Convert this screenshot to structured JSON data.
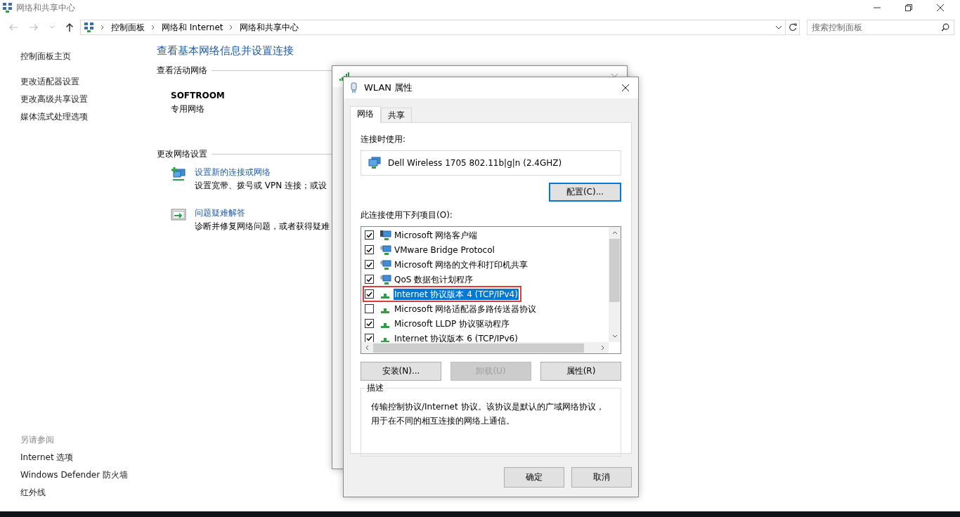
{
  "window": {
    "title": "网络和共享中心"
  },
  "address_bar": {
    "crumbs": [
      "控制面板",
      "网络和 Internet",
      "网络和共享中心"
    ]
  },
  "search": {
    "placeholder": "搜索控制面板"
  },
  "sidebar": {
    "items": [
      "控制面板主页",
      "更改适配器设置",
      "更改高级共享设置",
      "媒体流式处理选项"
    ],
    "see_also": {
      "heading": "另请参阅",
      "items": [
        "Internet 选项",
        "Windows Defender 防火墙",
        "红外线"
      ]
    }
  },
  "content": {
    "heading": "查看基本网络信息并设置连接",
    "active_networks": {
      "heading": "查看活动网络",
      "name": "SOFTROOM",
      "type": "专用网络"
    },
    "change_settings": {
      "heading": "更改网络设置",
      "tasks": [
        {
          "kind": "new-connection",
          "link": "设置新的连接或网络",
          "description": "设置宽带、拨号或 VPN 连接；或设"
        },
        {
          "kind": "troubleshoot",
          "link": "问题疑难解答",
          "description": "诊断并修复网络问题，或者获得疑难"
        }
      ]
    }
  },
  "properties_dialog": {
    "title": "WLAN 属性",
    "tabs": [
      {
        "label": "网络",
        "selected": true
      },
      {
        "label": "共享",
        "selected": false
      }
    ],
    "connect_using_label": "连接时使用:",
    "adapter": "Dell Wireless 1705 802.11b|g|n (2.4GHZ)",
    "configure_button": "配置(C)...",
    "items_label": "此连接使用下列项目(O):",
    "items": [
      {
        "label": "Microsoft 网络客户端",
        "kind": "client",
        "checked": true,
        "selected": false,
        "outlined": false
      },
      {
        "label": "VMware Bridge Protocol",
        "kind": "service",
        "checked": true,
        "selected": false,
        "outlined": false
      },
      {
        "label": "Microsoft 网络的文件和打印机共享",
        "kind": "service",
        "checked": true,
        "selected": false,
        "outlined": false
      },
      {
        "label": "QoS 数据包计划程序",
        "kind": "service",
        "checked": true,
        "selected": false,
        "outlined": false
      },
      {
        "label": "Internet 协议版本 4 (TCP/IPv4)",
        "kind": "protocol",
        "checked": true,
        "selected": true,
        "outlined": true
      },
      {
        "label": "Microsoft 网络适配器多路传送器协议",
        "kind": "protocol",
        "checked": false,
        "selected": false,
        "outlined": false
      },
      {
        "label": "Microsoft LLDP 协议驱动程序",
        "kind": "protocol",
        "checked": true,
        "selected": false,
        "outlined": false
      },
      {
        "label": "Internet 协议版本 6 (TCP/IPv6)",
        "kind": "protocol",
        "checked": true,
        "selected": false,
        "outlined": false
      }
    ],
    "item_buttons": [
      {
        "label": "安装(N)...",
        "disabled": false
      },
      {
        "label": "卸载(U)",
        "disabled": true
      },
      {
        "label": "属性(R)",
        "disabled": false
      }
    ],
    "description": {
      "heading": "描述",
      "text": "传输控制协议/Internet 协议。该协议是默认的广域网络协议，用于在不同的相互连接的网络上通信。"
    },
    "buttons": [
      "确定",
      "取消"
    ]
  }
}
